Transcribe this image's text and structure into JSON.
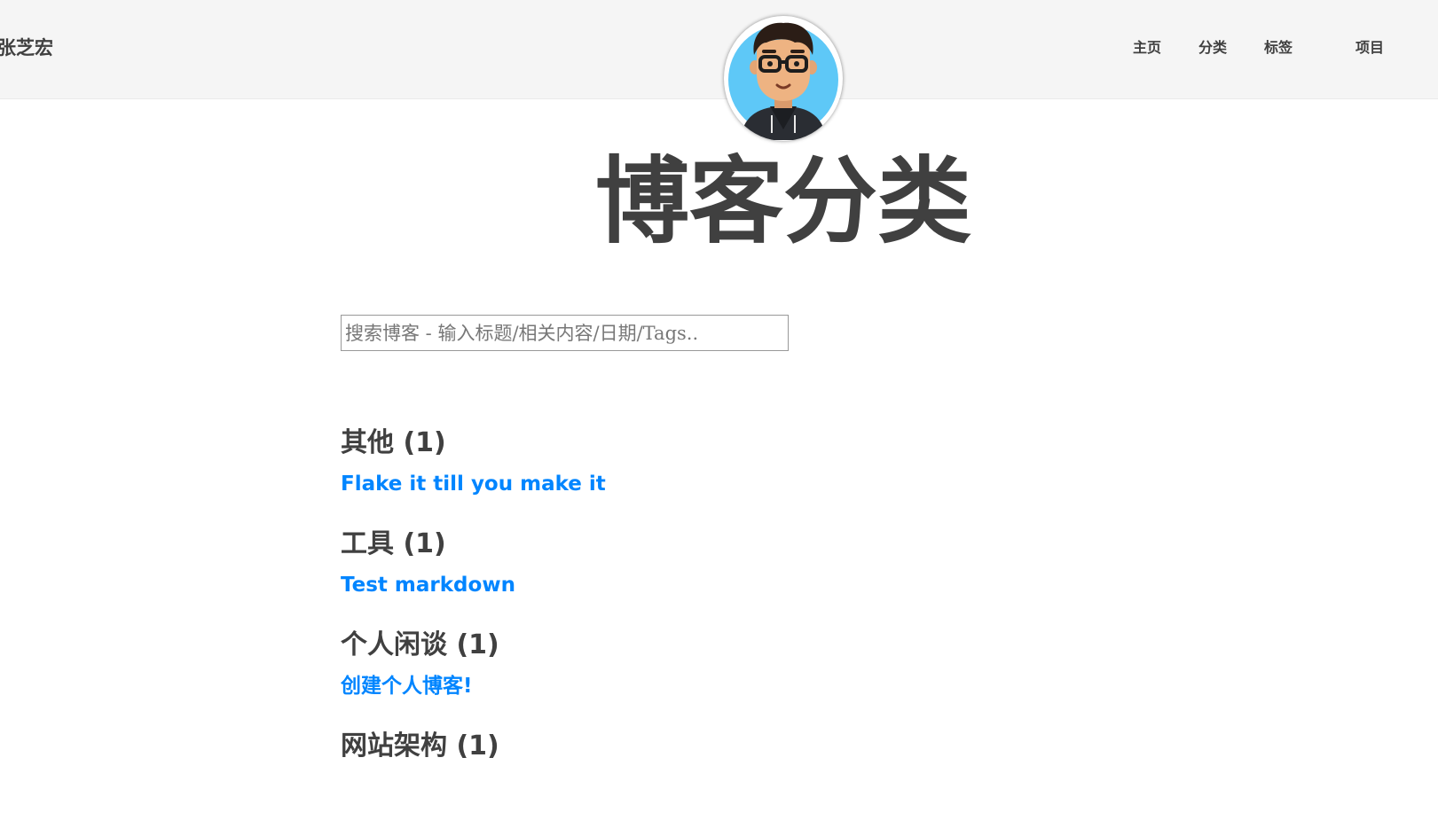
{
  "navbar": {
    "brand": "张芝宏",
    "links": [
      {
        "label": "主页"
      },
      {
        "label": "分类"
      },
      {
        "label": "标签"
      },
      {
        "label": "项目"
      }
    ]
  },
  "avatar": {
    "icon": "avatar-cartoon-man-with-glasses"
  },
  "page": {
    "title": "博客分类"
  },
  "search": {
    "value": "",
    "placeholder": "搜索博客 - 输入标题/相关内容/日期/Tags.."
  },
  "categories": [
    {
      "heading": "其他 (1)",
      "posts": [
        "Flake it till you make it"
      ]
    },
    {
      "heading": "工具 (1)",
      "posts": [
        "Test markdown"
      ]
    },
    {
      "heading": "个人闲谈 (1)",
      "posts": [
        "创建个人博客!"
      ]
    },
    {
      "heading": "网站架构 (1)",
      "posts": []
    }
  ],
  "colors": {
    "navbar_bg": "#f5f5f5",
    "text": "#404040",
    "link": "#0085ff"
  }
}
